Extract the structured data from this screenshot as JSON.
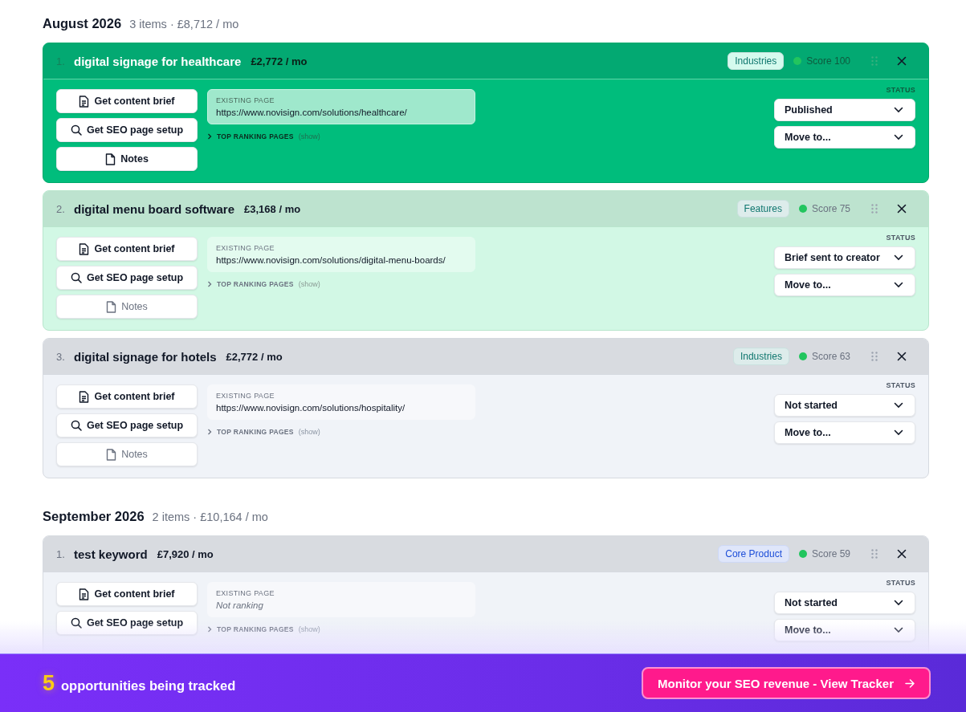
{
  "months": [
    {
      "title": "August 2026",
      "summary": "3 items · £8,712 / mo",
      "items": [
        {
          "number": "1.",
          "keyword": "digital signage for healthcare",
          "value": "£2,772 / mo",
          "kind": "published",
          "tag": {
            "label": "Industries",
            "color": "#0f766e"
          },
          "score": {
            "label": "Score 100",
            "color": "#22c55e"
          },
          "actions": {
            "brief": "Get content brief",
            "seo": "Get SEO page setup"
          },
          "notes": {
            "label": "Notes",
            "filled": true
          },
          "existing_label": "EXISTING PAGE",
          "existing_value": "https://www.novisign.com/solutions/healthcare/",
          "ranking_found": true,
          "top_ranking": "TOP RANKING PAGES",
          "show": "(show)",
          "status_label": "STATUS",
          "status": "Published",
          "move": "Move to..."
        },
        {
          "number": "2.",
          "keyword": "digital menu board software",
          "value": "£3,168 / mo",
          "kind": "briefed",
          "tag": {
            "label": "Features",
            "color": "#0f766e"
          },
          "score": {
            "label": "Score 75",
            "color": "#22c55e"
          },
          "actions": {
            "brief": "Get content brief",
            "seo": "Get SEO page setup"
          },
          "notes": {
            "label": "Notes",
            "filled": false
          },
          "existing_label": "EXISTING PAGE",
          "existing_value": "https://www.novisign.com/solutions/digital-menu-boards/",
          "ranking_found": true,
          "top_ranking": "TOP RANKING PAGES",
          "show": "(show)",
          "status_label": "STATUS",
          "status": "Brief sent to creator",
          "move": "Move to..."
        },
        {
          "number": "3.",
          "keyword": "digital signage for hotels",
          "value": "£2,772 / mo",
          "kind": "not_started",
          "tag": {
            "label": "Industries",
            "color": "#0f766e"
          },
          "score": {
            "label": "Score 63",
            "color": "#22c55e"
          },
          "actions": {
            "brief": "Get content brief",
            "seo": "Get SEO page setup"
          },
          "notes": {
            "label": "Notes",
            "filled": false
          },
          "existing_label": "EXISTING PAGE",
          "existing_value": "https://www.novisign.com/solutions/hospitality/",
          "ranking_found": true,
          "top_ranking": "TOP RANKING PAGES",
          "show": "(show)",
          "status_label": "STATUS",
          "status": "Not started",
          "move": "Move to..."
        }
      ]
    },
    {
      "title": "September 2026",
      "summary": "2 items · £10,164 / mo",
      "items": [
        {
          "number": "1.",
          "keyword": "test keyword",
          "value": "£7,920 / mo",
          "kind": "not_started",
          "tag": {
            "label": "Core Product",
            "color": "#1d4ed8"
          },
          "score": {
            "label": "Score 59",
            "color": "#22c55e"
          },
          "actions": {
            "brief": "Get content brief",
            "seo": "Get SEO page setup"
          },
          "existing_label": "EXISTING PAGE",
          "existing_value": "Not ranking",
          "ranking_found": false,
          "top_ranking": "TOP RANKING PAGES",
          "show": "(show)",
          "status_label": "STATUS",
          "status": "Not started",
          "move": "Move to..."
        }
      ]
    }
  ],
  "footer": {
    "count": "5",
    "label": "opportunities being tracked",
    "cta": "Monitor your SEO revenue - View Tracker"
  }
}
